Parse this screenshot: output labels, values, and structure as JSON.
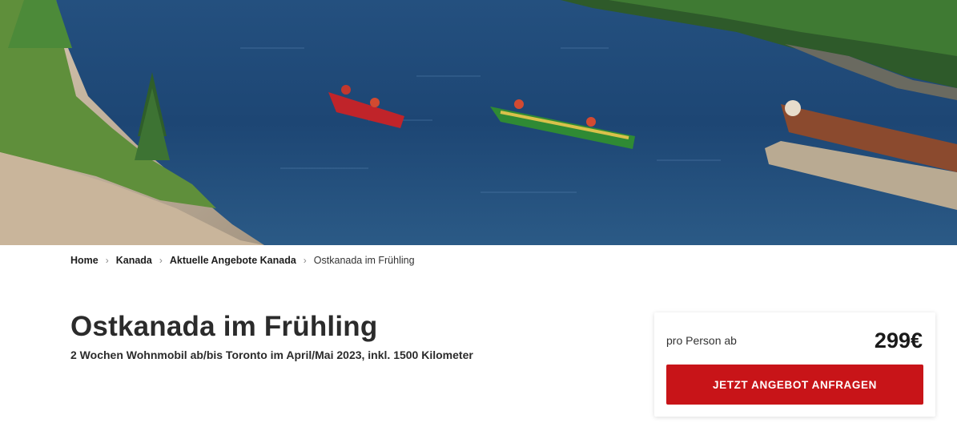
{
  "hero": {
    "image_description": "lake-canoes-hero-image"
  },
  "breadcrumb": [
    {
      "label": "Home"
    },
    {
      "label": "Kanada"
    },
    {
      "label": "Aktuelle Angebote Kanada"
    },
    {
      "label": "Ostkanada im Frühling"
    }
  ],
  "offer": {
    "title": "Ostkanada im Frühling",
    "subtitle": "2 Wochen Wohnmobil ab/bis Toronto im April/Mai 2023, inkl. 1500 Kilometer"
  },
  "price_box": {
    "label": "pro Person ab",
    "price": "299€",
    "cta_label": "JETZT ANGEBOT ANFRAGEN"
  },
  "colors": {
    "accent": "#c81418",
    "text": "#2b2b2b",
    "water": "#1f4a7a"
  },
  "icons": {
    "breadcrumb_separator": "chevron-right-icon"
  }
}
